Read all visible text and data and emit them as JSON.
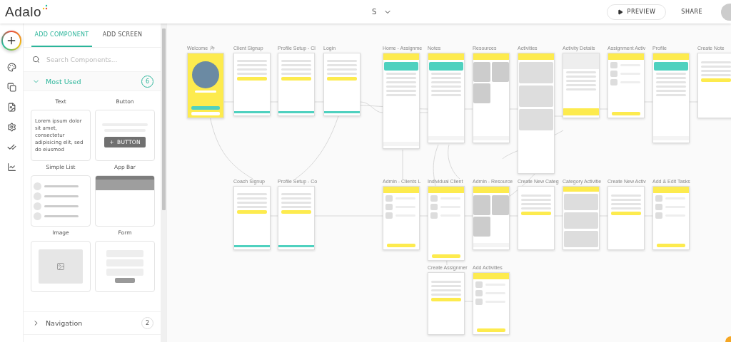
{
  "header": {
    "logo": "Adalo",
    "app_name": "S",
    "preview": "PREVIEW",
    "share": "SHARE"
  },
  "panel": {
    "tabs": [
      {
        "label": "ADD COMPONENT",
        "selected": true
      },
      {
        "label": "ADD SCREEN",
        "selected": false
      }
    ],
    "search": {
      "placeholder": "Search Components..."
    },
    "sections": [
      {
        "title": "Most Used",
        "count": "6",
        "expanded": true,
        "components": [
          {
            "name": "Text",
            "kind": "text",
            "sample": "Lorem ipsum dolor sit amet, consectetur adipisicing elit, sed do eiusmod"
          },
          {
            "name": "Button",
            "kind": "button",
            "sample": "BUTTON"
          },
          {
            "name": "Simple List",
            "kind": "list"
          },
          {
            "name": "App Bar",
            "kind": "appbar"
          },
          {
            "name": "Image",
            "kind": "image"
          },
          {
            "name": "Form",
            "kind": "form"
          }
        ]
      },
      {
        "title": "Navigation",
        "count": "2",
        "expanded": false
      }
    ]
  },
  "canvas": {
    "screens": [
      {
        "title": "Welcome",
        "kind": "splash",
        "home": true
      },
      {
        "title": "Client Signup",
        "kind": "signup",
        "home": false
      },
      {
        "title": "Profile Setup - Cl",
        "kind": "signup",
        "home": false
      },
      {
        "title": "Login",
        "kind": "signup",
        "home": false
      },
      {
        "title": "Home - Assignme",
        "kind": "app",
        "home": false
      },
      {
        "title": "Notes",
        "kind": "app",
        "home": false
      },
      {
        "title": "Resources",
        "kind": "grid",
        "home": false
      },
      {
        "title": "Activities",
        "kind": "cards",
        "home": false
      },
      {
        "title": "Activity Details",
        "kind": "detail",
        "home": false
      },
      {
        "title": "Assignment Activ",
        "kind": "list",
        "home": false
      },
      {
        "title": "Profile",
        "kind": "app",
        "home": false
      },
      {
        "title": "Create Note",
        "kind": "plain",
        "home": false
      },
      {
        "title": "Coach Signup",
        "kind": "signup",
        "home": false
      },
      {
        "title": "Profile Setup - Co",
        "kind": "signup",
        "home": false
      },
      {
        "title": "Admin - Clients L",
        "kind": "list",
        "home": false
      },
      {
        "title": "Individual Client",
        "kind": "list",
        "home": false
      },
      {
        "title": "Admin - Resource",
        "kind": "grid",
        "home": false
      },
      {
        "title": "Create New Categ",
        "kind": "plain",
        "home": false
      },
      {
        "title": "Category Activitie",
        "kind": "cards",
        "home": false
      },
      {
        "title": "Create New Activ",
        "kind": "plain",
        "home": false
      },
      {
        "title": "Add & Edit Tasks",
        "kind": "list",
        "home": false
      },
      {
        "title": "Create Assignmer",
        "kind": "plain",
        "home": false
      },
      {
        "title": "Add Activities",
        "kind": "list",
        "home": false
      }
    ]
  }
}
